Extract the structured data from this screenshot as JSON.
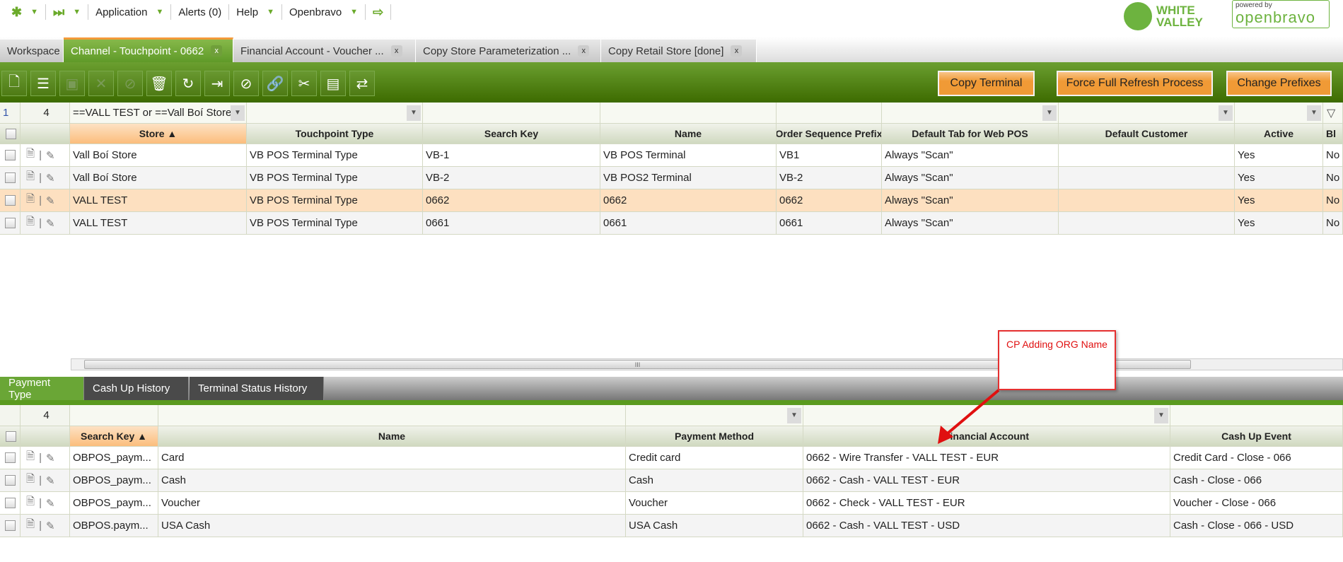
{
  "topnav": {
    "items": [
      {
        "label": "Application"
      },
      {
        "label": "Alerts (0)"
      },
      {
        "label": "Help"
      },
      {
        "label": "Openbravo"
      }
    ]
  },
  "logos": {
    "white_valley": "WHITE VALLEY",
    "powered_by": "powered by",
    "openbravo": "openbravo"
  },
  "tabs": [
    {
      "label": "Workspace"
    },
    {
      "label": "Channel - Touchpoint - 0662"
    },
    {
      "label": "Financial Account - Voucher ..."
    },
    {
      "label": "Copy Store Parameterization ..."
    },
    {
      "label": "Copy Retail Store [done]"
    }
  ],
  "close_glyph": "x",
  "toolbar": {
    "icons": [
      "new-document-icon",
      "new-row-icon",
      "save-icon",
      "undo-icon",
      "cancel-icon",
      "delete-icon",
      "refresh-icon",
      "export-icon",
      "attachment-icon",
      "link-icon",
      "tools-icon",
      "layout-icon",
      "checklist-icon"
    ],
    "buttons": [
      "Copy Terminal",
      "Force Full Refresh Process",
      "Change Prefixes"
    ]
  },
  "grid": {
    "page": "1",
    "count": "4",
    "store_filter": "==VALL TEST or ==Vall Boí Store",
    "columns": [
      "Store ▲",
      "Touchpoint Type",
      "Search Key",
      "Name",
      "Order Sequence Prefix",
      "Default Tab for Web POS",
      "Default Customer",
      "Active",
      "Bl"
    ],
    "rows": [
      [
        "Vall Boí Store",
        "VB POS Terminal Type",
        "VB-1",
        "VB POS Terminal",
        "VB1",
        "Always \"Scan\"",
        "",
        "Yes",
        "No"
      ],
      [
        "Vall Boí Store",
        "VB POS Terminal Type",
        "VB-2",
        "VB POS2 Terminal",
        "VB-2",
        "Always \"Scan\"",
        "",
        "Yes",
        "No"
      ],
      [
        "VALL TEST",
        "VB POS Terminal Type",
        "0662",
        "0662",
        "0662",
        "Always \"Scan\"",
        "",
        "Yes",
        "No"
      ],
      [
        "VALL TEST",
        "VB POS Terminal Type",
        "0661",
        "0661",
        "0661",
        "Always \"Scan\"",
        "",
        "Yes",
        "No"
      ]
    ],
    "selected_row": 2
  },
  "scroll_grip": "III",
  "subtabs": [
    {
      "label": "Payment Type"
    },
    {
      "label": "Cash Up History"
    },
    {
      "label": "Terminal Status History"
    }
  ],
  "subgrid": {
    "count": "4",
    "columns": [
      "Search Key ▲",
      "Name",
      "Payment Method",
      "Financial Account",
      "Cash Up Event"
    ],
    "rows": [
      [
        "OBPOS_paym...",
        "Card",
        "Credit card",
        "0662 - Wire Transfer - VALL TEST - EUR",
        "Credit Card - Close - 066"
      ],
      [
        "OBPOS_paym...",
        "Cash",
        "Cash",
        "0662 - Cash - VALL TEST - EUR",
        "Cash - Close - 066"
      ],
      [
        "OBPOS_paym...",
        "Voucher",
        "Voucher",
        "0662 - Check - VALL TEST - EUR",
        "Voucher - Close - 066"
      ],
      [
        "OBPOS.paym...",
        "USA Cash",
        "USA Cash",
        "0662 - Cash - VALL TEST - USD",
        "Cash - Close - 066 - USD"
      ]
    ]
  },
  "annotation": {
    "text": "CP Adding ORG Name",
    "color": "#e01010"
  }
}
